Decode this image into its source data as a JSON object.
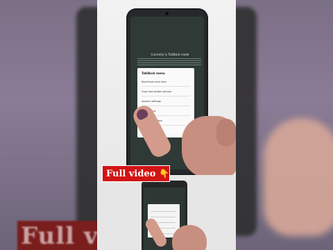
{
  "video": {
    "banner_text": "Full video",
    "banner_emoji": "👇",
    "banner_color": "#d21414"
  },
  "phone_screen": {
    "title": "Currently in TalkBack mode",
    "dialog_title": "TalkBack menu",
    "dialog_items": [
      "Read from next item",
      "Copy last spoken phrase",
      "Speech settings",
      "Edit actions",
      "Select a previous"
    ],
    "dialog_ok": "Close"
  },
  "side_banner_text": "Full vide",
  "icons": {
    "pointing_down": "pointing-down-emoji"
  }
}
